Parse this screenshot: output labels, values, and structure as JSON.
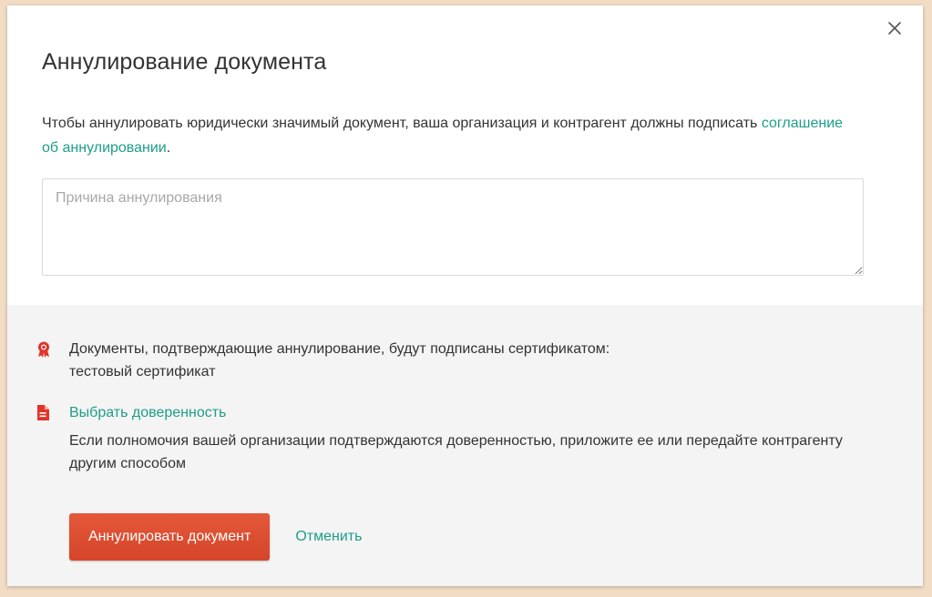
{
  "dialog": {
    "title": "Аннулирование документа",
    "close_icon": "close-icon",
    "description_prefix": "Чтобы аннулировать юридически значимый документ, ваша организация и контрагент должны подписать ",
    "description_link": "соглашение об аннулировании",
    "description_suffix": ".",
    "reason_placeholder": "Причина аннулирования",
    "reason_value": ""
  },
  "footer": {
    "certificate": {
      "icon": "award-badge-icon",
      "text": "Документы, подтверждающие аннулирование, будут подписаны сертификатом:",
      "name": "тестовый сертификат"
    },
    "power_of_attorney": {
      "icon": "document-icon",
      "link_label": "Выбрать доверенность",
      "description": "Если полномочия вашей организации подтверждаются доверенностью, приложите ее или передайте контрагенту другим способом"
    },
    "actions": {
      "primary_label": "Аннулировать документ",
      "cancel_label": "Отменить"
    }
  },
  "colors": {
    "accent_link": "#1e9e88",
    "danger_button": "#df4f2f",
    "icon_red": "#e0342a",
    "page_background": "#f2dcc5",
    "footer_background": "#f4f4f4"
  }
}
